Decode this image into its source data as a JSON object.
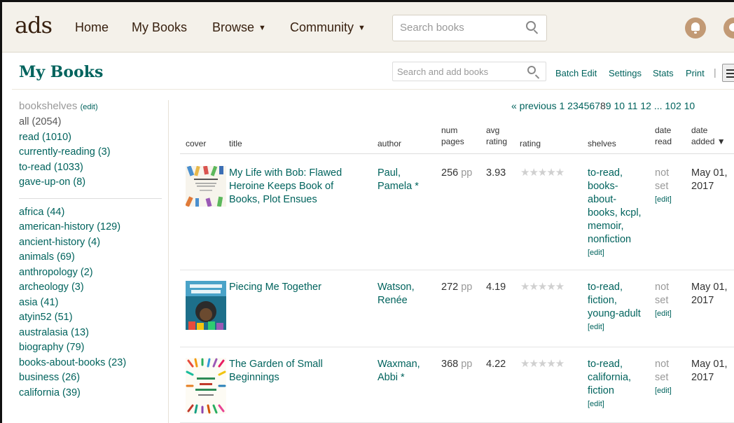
{
  "topbar": {
    "logo": "ads",
    "nav": [
      {
        "label": "Home"
      },
      {
        "label": "My Books"
      },
      {
        "label": "Browse",
        "caret": "▼"
      },
      {
        "label": "Community",
        "caret": "▼"
      }
    ],
    "search_placeholder": "Search books",
    "icons": [
      "notification-bell-icon",
      "message-icon"
    ]
  },
  "page": {
    "title": "My Books",
    "shelf_search_placeholder": "Search and add books",
    "toolbar": [
      "Batch Edit",
      "Settings",
      "Stats",
      "Print"
    ],
    "separator": "|"
  },
  "sidebar": {
    "heading": "bookshelves",
    "heading_edit": "(edit)",
    "status_shelves": [
      "all (2054)",
      "read (1010)",
      "currently-reading (3)",
      "to-read (1033)",
      "gave-up-on (8)"
    ],
    "shelves": [
      "africa (44)",
      "american-history (129)",
      "ancient-history (4)",
      "animals (69)",
      "anthropology (2)",
      "archeology (3)",
      "asia (41)",
      "atyin52 (51)",
      "australasia (13)",
      "biography (79)",
      "books-about-books (23)",
      "business (26)",
      "california (39)"
    ]
  },
  "pagination": {
    "prev": "« previous",
    "pages": [
      "1",
      "2",
      "3",
      "4",
      "5",
      "6",
      "7",
      "8",
      "9",
      "10",
      "11",
      "12",
      "...",
      "102",
      "10"
    ]
  },
  "table": {
    "headers": {
      "cover": "cover",
      "title": "title",
      "author": "author",
      "num_pages_1": "num",
      "num_pages_2": "pages",
      "avg_rating_1": "avg",
      "avg_rating_2": "rating",
      "rating": "rating",
      "shelves": "shelves",
      "date_read_1": "date",
      "date_read_2": "read",
      "date_added_1": "date",
      "date_added_2": "added",
      "sort_caret": "▼"
    },
    "rows": [
      {
        "title_lines": [
          "My Life with Bob: Flawed",
          "Heroine Keeps Book of",
          "Books, Plot Ensues"
        ],
        "author_lines": [
          "Paul,",
          "Pamela *"
        ],
        "pages": "256",
        "pp": "pp",
        "avg_rating": "3.93",
        "stars": "★★★★★",
        "shelves_lines": [
          "to-read,",
          "books-",
          "about-",
          "books, kcpl,",
          "memoir,",
          "nonfiction"
        ],
        "shelves_edit": "[edit]",
        "date_read_lines": [
          "not",
          "set"
        ],
        "date_read_edit": "[edit]",
        "date_added_lines": [
          "May 01,",
          "2017"
        ]
      },
      {
        "title_lines": [
          "Piecing Me Together"
        ],
        "author_lines": [
          "Watson,",
          "Renée"
        ],
        "pages": "272",
        "pp": "pp",
        "avg_rating": "4.19",
        "stars": "★★★★★",
        "shelves_lines": [
          "to-read,",
          "fiction,",
          "young-adult"
        ],
        "shelves_edit": "[edit]",
        "date_read_lines": [
          "not",
          "set"
        ],
        "date_read_edit": "[edit]",
        "date_added_lines": [
          "May 01,",
          "2017"
        ]
      },
      {
        "title_lines": [
          "The Garden of Small",
          "Beginnings"
        ],
        "author_lines": [
          "Waxman,",
          "Abbi *"
        ],
        "pages": "368",
        "pp": "pp",
        "avg_rating": "4.22",
        "stars": "★★★★★",
        "shelves_lines": [
          "to-read,",
          "california,",
          "fiction"
        ],
        "shelves_edit": "[edit]",
        "date_read_lines": [
          "not",
          "set"
        ],
        "date_read_edit": "[edit]",
        "date_added_lines": [
          "May 01,",
          "2017"
        ]
      }
    ]
  }
}
